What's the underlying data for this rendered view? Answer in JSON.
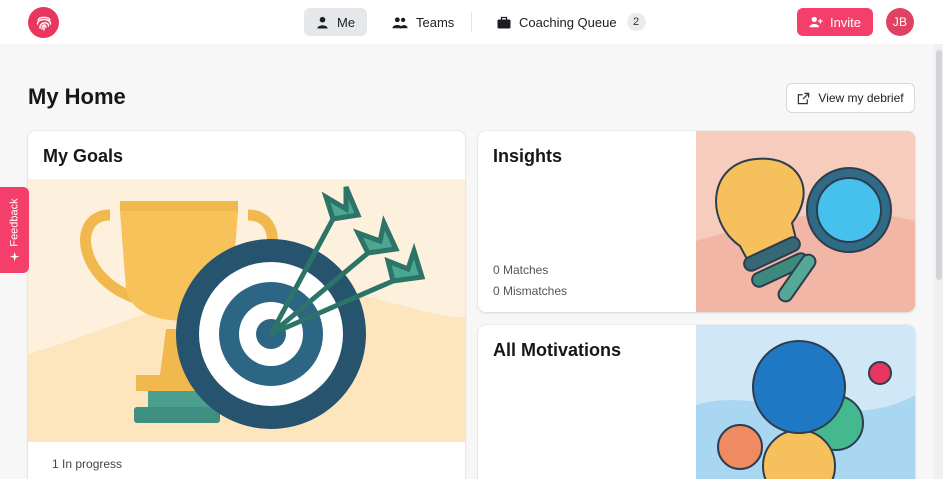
{
  "nav": {
    "tabs": [
      {
        "label": "Me",
        "icon": "person-icon",
        "active": true
      },
      {
        "label": "Teams",
        "icon": "people-icon",
        "active": false
      },
      {
        "label": "Coaching Queue",
        "icon": "briefcase-icon",
        "active": false,
        "badge": "2"
      }
    ],
    "invite_label": "Invite",
    "avatar_initials": "JB"
  },
  "page": {
    "title": "My Home",
    "debrief_label": "View my debrief"
  },
  "cards": {
    "goals": {
      "title": "My Goals",
      "status": "1 In progress"
    },
    "insights": {
      "title": "Insights",
      "matches": "0 Matches",
      "mismatches": "0 Mismatches"
    },
    "motivations": {
      "title": "All Motivations"
    }
  },
  "feedback_label": "Feedback",
  "colors": {
    "accent": "#f43f6b",
    "avatar": "#e04362",
    "goals_bg": "#fdf0dd",
    "insights_bg": "#f6cdbd",
    "motivations_bg": "#cfe7f7"
  }
}
